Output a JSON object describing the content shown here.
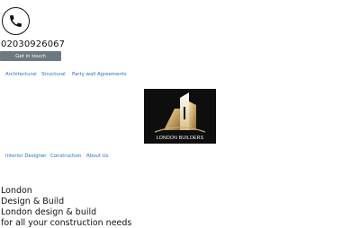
{
  "header": {
    "phone_icon": "phone-icon",
    "phone_number": "02030926067",
    "cta_label": "Get in touch"
  },
  "nav_top": {
    "items": [
      "Architectural",
      "Structural",
      "Party wall Agreements"
    ]
  },
  "logo": {
    "text": "LONDON BUILDERS",
    "background": "#0e0e0e",
    "accent": "#c9a96a"
  },
  "nav_bottom": {
    "items": [
      "Interior Designer",
      "Construction",
      "About Us"
    ]
  },
  "intro": {
    "lines": [
      "London",
      "Design & Build",
      "London design & build",
      "for all your construction needs"
    ]
  },
  "colors": {
    "link": "#2a6ebf",
    "button_bg": "#6c7a80"
  }
}
